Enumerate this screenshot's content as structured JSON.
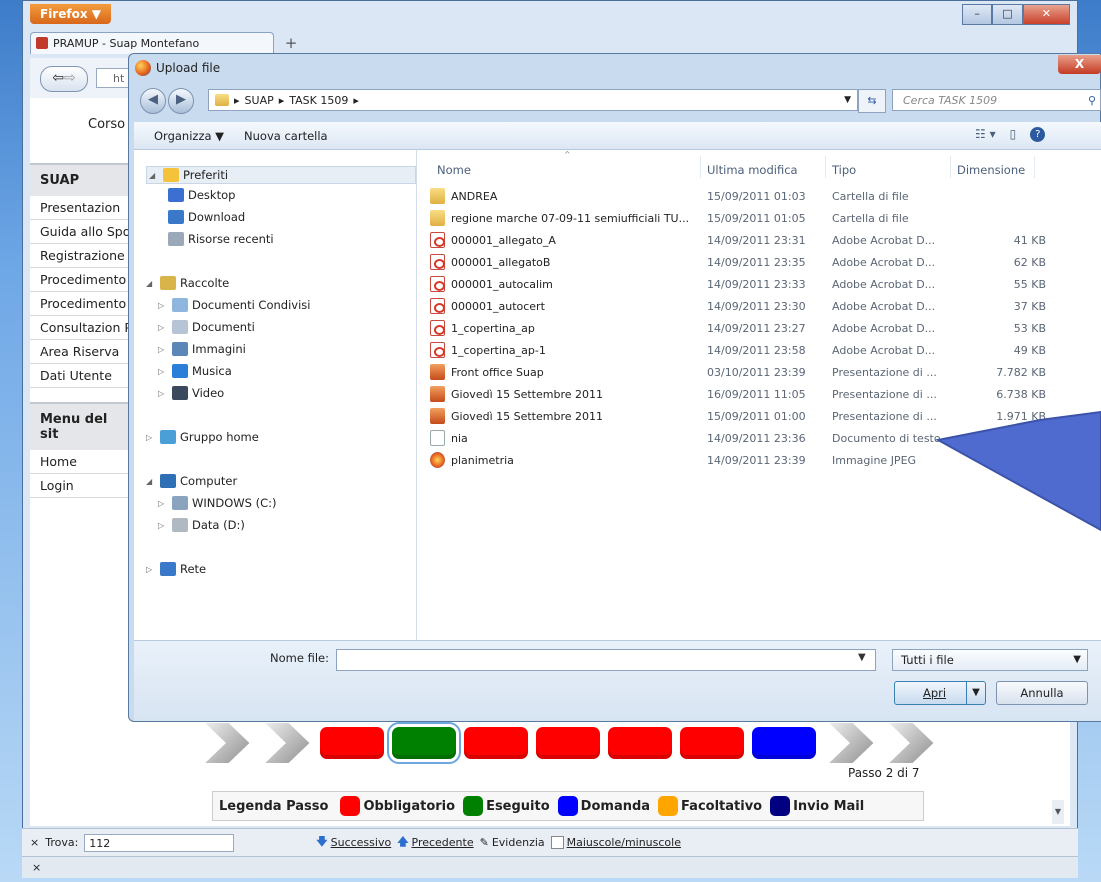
{
  "browser": {
    "menu_label": "Firefox ▼",
    "tab_title": "PRAMUP - Suap Montefano",
    "new_tab": "+",
    "url_fragment": "ht"
  },
  "page": {
    "corso_label": "Corso",
    "sidebar": {
      "heading": "SUAP",
      "items": [
        "Presentazion",
        "Guida allo Sportello",
        "Registrazione Accreditamer",
        "Procedimento",
        "Procedimento Ordinario",
        "Consultazion Pratiche",
        "Area Riserva",
        "Dati Utente"
      ],
      "heading2": "Menu del sit",
      "items2": [
        "Home",
        "Login"
      ]
    },
    "steps": {
      "colors": [
        "#ff0000",
        "#008000",
        "#ff0000",
        "#ff0000",
        "#ff0000",
        "#ff0000",
        "#0000ff"
      ],
      "passo": "Passo 2 di 7"
    },
    "legend": {
      "title": "Legenda Passo",
      "items": [
        {
          "label": "Obbligatorio",
          "color": "#ff0000"
        },
        {
          "label": "Eseguito",
          "color": "#008000"
        },
        {
          "label": "Domanda",
          "color": "#0000ff"
        },
        {
          "label": "Facoltativo",
          "color": "#ffa500"
        },
        {
          "label": "Invio Mail",
          "color": "#000080"
        }
      ]
    }
  },
  "findbar": {
    "close": "×",
    "label": "Trova:",
    "value": "112",
    "next": "Successivo",
    "prev": "Precedente",
    "highlight": "Evidenzia",
    "matchcase": "Maiuscole/minuscole"
  },
  "statusbar": {
    "close": "×"
  },
  "dialog": {
    "title": "Upload file",
    "close": "X",
    "path": [
      "SUAP",
      "TASK 1509"
    ],
    "search_placeholder": "Cerca TASK 1509",
    "toolbar": {
      "organize": "Organizza ▼",
      "new_folder": "Nuova cartella"
    },
    "nav": {
      "favorites": "Preferiti",
      "fav_items": [
        "Desktop",
        "Download",
        "Risorse recenti"
      ],
      "libraries": "Raccolte",
      "lib_items": [
        "Documenti Condivisi",
        "Documenti",
        "Immagini",
        "Musica",
        "Video"
      ],
      "homegroup": "Gruppo home",
      "computer": "Computer",
      "drives": [
        "WINDOWS (C:)",
        "Data (D:)"
      ],
      "network": "Rete"
    },
    "columns": {
      "name": "Nome",
      "modified": "Ultima modifica",
      "type": "Tipo",
      "size": "Dimensione"
    },
    "files": [
      {
        "name": "ANDREA",
        "modified": "15/09/2011 01:03",
        "type": "Cartella di file",
        "size": "",
        "icon": "folder-icon"
      },
      {
        "name": "regione marche 07-09-11 semiufficiali TU...",
        "modified": "15/09/2011 01:05",
        "type": "Cartella di file",
        "size": "",
        "icon": "folder-icon"
      },
      {
        "name": "000001_allegato_A",
        "modified": "14/09/2011 23:31",
        "type": "Adobe Acrobat D...",
        "size": "41 KB",
        "icon": "pdf-icon"
      },
      {
        "name": "000001_allegatoB",
        "modified": "14/09/2011 23:35",
        "type": "Adobe Acrobat D...",
        "size": "62 KB",
        "icon": "pdf-icon"
      },
      {
        "name": "000001_autocalim",
        "modified": "14/09/2011 23:33",
        "type": "Adobe Acrobat D...",
        "size": "55 KB",
        "icon": "pdf-icon"
      },
      {
        "name": "000001_autocert",
        "modified": "14/09/2011 23:30",
        "type": "Adobe Acrobat D...",
        "size": "37 KB",
        "icon": "pdf-icon"
      },
      {
        "name": "1_copertina_ap",
        "modified": "14/09/2011 23:27",
        "type": "Adobe Acrobat D...",
        "size": "53 KB",
        "icon": "pdf-icon"
      },
      {
        "name": "1_copertina_ap-1",
        "modified": "14/09/2011 23:58",
        "type": "Adobe Acrobat D...",
        "size": "49 KB",
        "icon": "pdf-icon"
      },
      {
        "name": "Front office Suap",
        "modified": "03/10/2011 23:39",
        "type": "Presentazione di ...",
        "size": "7.782 KB",
        "icon": "presentation-icon"
      },
      {
        "name": "Giovedì 15 Settembre 2011",
        "modified": "16/09/2011 11:05",
        "type": "Presentazione di ...",
        "size": "6.738 KB",
        "icon": "presentation-icon"
      },
      {
        "name": "Giovedì 15 Settembre 2011",
        "modified": "15/09/2011 01:00",
        "type": "Presentazione di ...",
        "size": "1.971 KB",
        "icon": "presentation-icon"
      },
      {
        "name": "nia",
        "modified": "14/09/2011 23:36",
        "type": "Documento di testo",
        "size": "",
        "icon": "text-file-icon"
      },
      {
        "name": "planimetria",
        "modified": "14/09/2011 23:39",
        "type": "Immagine JPEG",
        "size": "",
        "icon": "image-file-icon"
      }
    ],
    "filename_label": "Nome file:",
    "filename_value": "",
    "filetype": "Tutti i file",
    "open": "Apri",
    "cancel": "Annulla"
  }
}
